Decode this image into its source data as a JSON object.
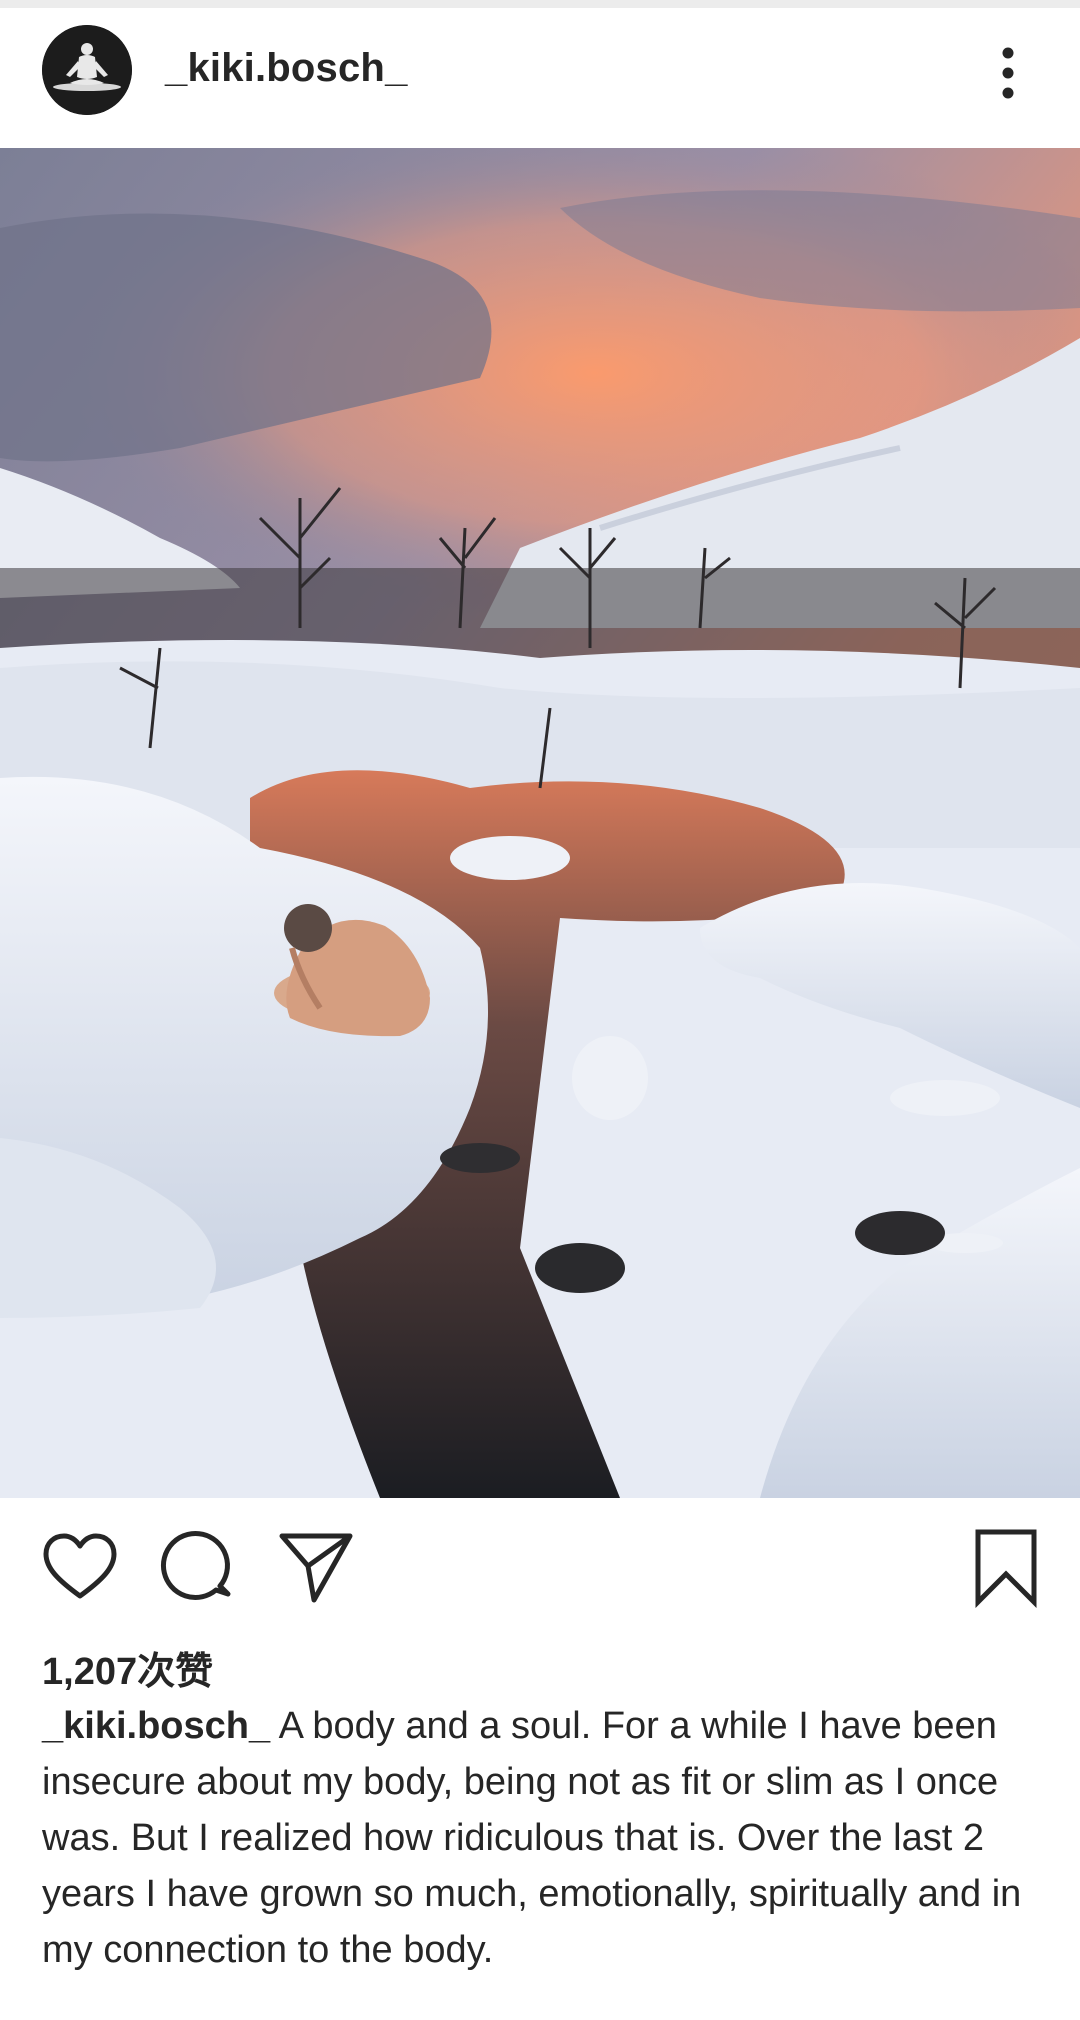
{
  "post": {
    "username": "_kiki.bosch_",
    "likes_text": "1,207次赞",
    "caption_user": "_kiki.bosch_",
    "caption_text": " A body and a soul. For a while I have been insecure about my body, being not as fit or slim as I once was. But I realized how ridiculous that is. Over the last 2 years I have grown so much, emotionally, spiritually and in my connection to the body."
  },
  "icons": {
    "avatar": "meditation-avatar",
    "more": "more-vertical-icon",
    "like": "heart-icon",
    "comment": "comment-icon",
    "share": "paper-plane-icon",
    "save": "bookmark-icon"
  },
  "colors": {
    "text": "#262626",
    "background": "#ffffff",
    "divider": "#ececec"
  }
}
